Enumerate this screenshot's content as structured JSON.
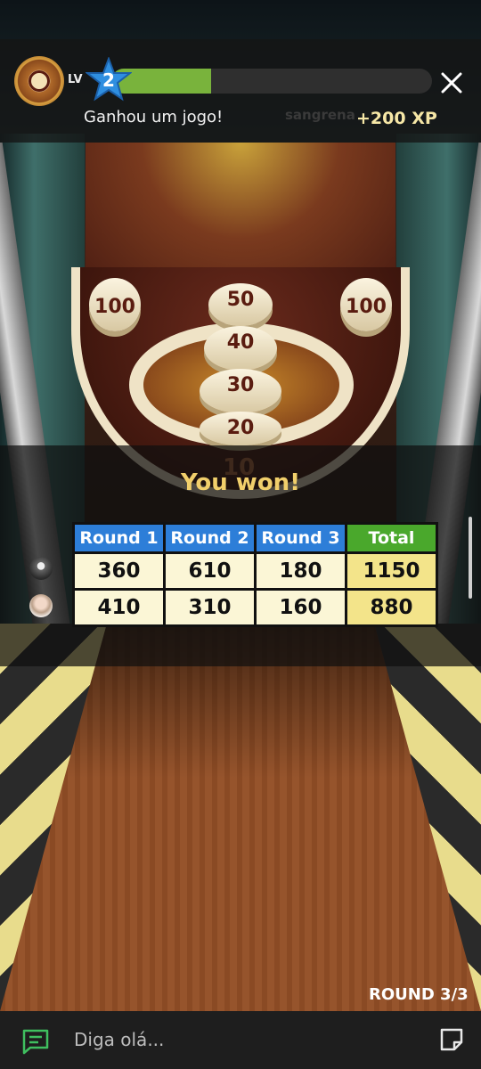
{
  "hud": {
    "level_label": "LV",
    "level": "2",
    "xp_progress": 0.31,
    "message": "Ganhou um jogo!",
    "xp_gain": "+200 XP",
    "opponent_name_partial": "sangrena"
  },
  "board": {
    "cups": [
      "100",
      "50",
      "100",
      "40",
      "30",
      "20",
      "10"
    ]
  },
  "result": {
    "title": "You won!",
    "headers": [
      "Round 1",
      "Round 2",
      "Round 3",
      "Total"
    ],
    "rows": [
      {
        "scores": [
          "360",
          "610",
          "180"
        ],
        "total": "1150"
      },
      {
        "scores": [
          "410",
          "310",
          "160"
        ],
        "total": "880"
      }
    ]
  },
  "round_indicator": "ROUND 3/3",
  "chat": {
    "placeholder": "Diga olá..."
  },
  "colors": {
    "header_blue": "#2d7ed8",
    "header_green": "#4aa82c",
    "xp_green": "#79b33c",
    "won_gold": "#f1cf6b"
  },
  "icons": [
    "close-icon",
    "chat-icon",
    "sticker-icon",
    "level-star-icon",
    "player-badge-icon"
  ]
}
